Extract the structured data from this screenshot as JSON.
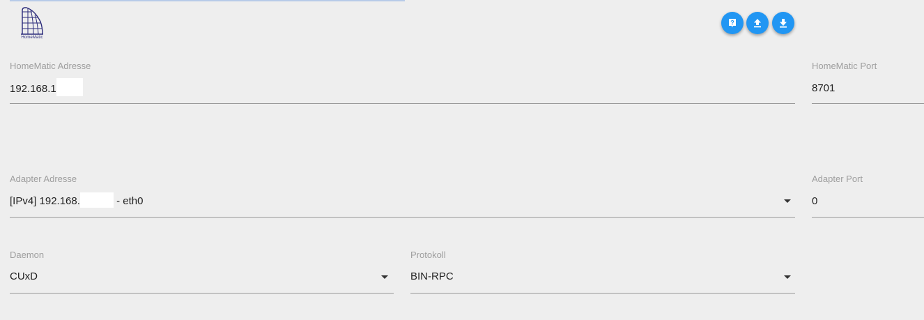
{
  "header": {
    "logo_text": "HomeMatic",
    "logo_icon": "homematic-logo-icon",
    "buttons": [
      {
        "icon": "help-icon"
      },
      {
        "icon": "upload-icon"
      },
      {
        "icon": "download-icon"
      }
    ],
    "accent_color": "#2196f3"
  },
  "form": {
    "homematic_address": {
      "label": "HomeMatic Adresse",
      "value": "192.168.1"
    },
    "homematic_port": {
      "label": "HomeMatic Port",
      "value": "8701"
    },
    "adapter_address": {
      "label": "Adapter Adresse",
      "value_prefix": "[IPv4] 192.168.",
      "value_suffix": " - eth0"
    },
    "adapter_port": {
      "label": "Adapter Port",
      "value": "0"
    },
    "daemon": {
      "label": "Daemon",
      "value": "CUxD"
    },
    "protocol": {
      "label": "Protokoll",
      "value": "BIN-RPC"
    }
  }
}
